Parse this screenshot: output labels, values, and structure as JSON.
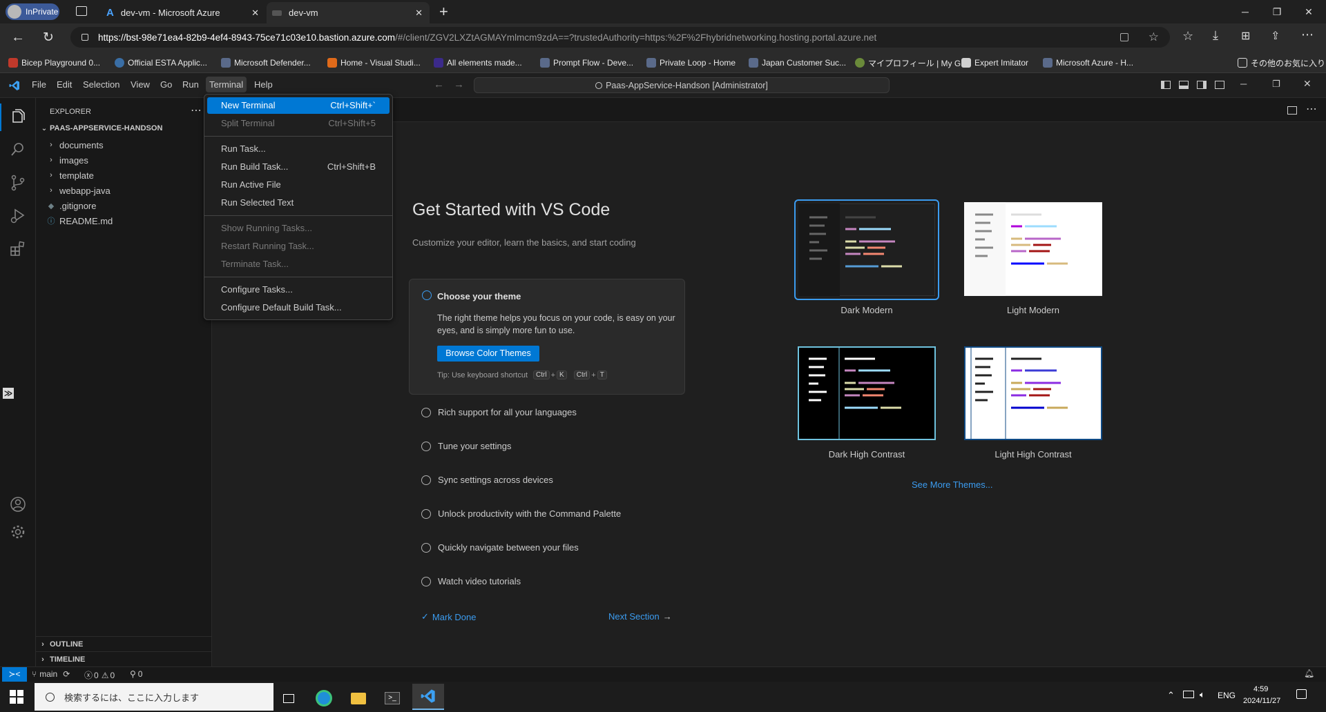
{
  "browser": {
    "inprivate_label": "InPrivate",
    "tabs": [
      {
        "title": "dev-vm - Microsoft Azure"
      },
      {
        "title": "dev-vm"
      }
    ],
    "url_host": "https://bst-98e71ea4-82b9-4ef4-8943-75ce71c03e10.bastion.azure.com",
    "url_rest": "/#/client/ZGV2LXZtAGMAYmlmcm9zdA==?trustedAuthority=https:%2F%2Fhybridnetworking.hosting.portal.azure.net",
    "favorites": [
      {
        "label": "Bicep Playground 0...",
        "color": "#c0392b"
      },
      {
        "label": "Official ESTA Applic...",
        "color": "#3a6ea5"
      },
      {
        "label": "Microsoft Defender...",
        "color": "#5a6a8a"
      },
      {
        "label": "Home - Visual Studi...",
        "color": "#e06a1a"
      },
      {
        "label": "All elements made...",
        "color": "#3b2a8a"
      },
      {
        "label": "Prompt Flow - Deve...",
        "color": "#5a6a8a"
      },
      {
        "label": "Private Loop - Home",
        "color": "#5a6a8a"
      },
      {
        "label": "Japan Customer Suc...",
        "color": "#5a6a8a"
      },
      {
        "label": "マイプロフィール | My G...",
        "color": "#6a8a3a"
      },
      {
        "label": "Expert Imitator",
        "color": "#d0d0d0"
      },
      {
        "label": "Microsoft Azure - H...",
        "color": "#5a6a8a"
      }
    ],
    "other_favorites": "その他のお気に入り"
  },
  "vscode": {
    "menu": [
      "File",
      "Edit",
      "Selection",
      "View",
      "Go",
      "Run",
      "Terminal",
      "Help"
    ],
    "command_center": "Paas-AppService-Handson [Administrator]",
    "explorer": {
      "title": "EXPLORER",
      "root": "PAAS-APPSERVICE-HANDSON",
      "items": [
        {
          "label": "documents",
          "type": "folder"
        },
        {
          "label": "images",
          "type": "folder"
        },
        {
          "label": "template",
          "type": "folder"
        },
        {
          "label": "webapp-java",
          "type": "folder"
        },
        {
          "label": ".gitignore",
          "type": "file"
        },
        {
          "label": "README.md",
          "type": "file"
        }
      ],
      "outline": "OUTLINE",
      "timeline": "TIMELINE"
    },
    "terminal_menu": {
      "new_terminal": {
        "label": "New Terminal",
        "key": "Ctrl+Shift+`"
      },
      "split_terminal": {
        "label": "Split Terminal",
        "key": "Ctrl+Shift+5"
      },
      "run_task": {
        "label": "Run Task..."
      },
      "run_build_task": {
        "label": "Run Build Task...",
        "key": "Ctrl+Shift+B"
      },
      "run_active_file": {
        "label": "Run Active File"
      },
      "run_selected_text": {
        "label": "Run Selected Text"
      },
      "show_running_tasks": {
        "label": "Show Running Tasks..."
      },
      "restart_running_task": {
        "label": "Restart Running Task..."
      },
      "terminate_task": {
        "label": "Terminate Task..."
      },
      "configure_tasks": {
        "label": "Configure Tasks..."
      },
      "configure_default_build": {
        "label": "Configure Default Build Task..."
      }
    },
    "welcome": {
      "title": "Get Started with VS Code",
      "subtitle": "Customize your editor, learn the basics, and start coding",
      "step_active": {
        "title": "Choose your theme",
        "desc": "The right theme helps you focus on your code, is easy on your eyes, and is simply more fun to use.",
        "button": "Browse Color Themes",
        "tip": "Tip: Use keyboard shortcut",
        "keys": [
          "Ctrl",
          "+",
          "K",
          "Ctrl",
          "+",
          "T"
        ]
      },
      "steps": [
        "Rich support for all your languages",
        "Tune your settings",
        "Sync settings across devices",
        "Unlock productivity with the Command Palette",
        "Quickly navigate between your files",
        "Watch video tutorials"
      ],
      "mark_done": "Mark Done",
      "next_section": "Next Section",
      "themes": [
        "Dark Modern",
        "Light Modern",
        "Dark High Contrast",
        "Light High Contrast"
      ],
      "see_more": "See More Themes..."
    },
    "status": {
      "branch": "main",
      "errors": "0",
      "warnings": "0",
      "ports": "0"
    }
  },
  "taskbar": {
    "search_placeholder": "検索するには、ここに入力します",
    "lang": "ENG",
    "time": "4:59",
    "date": "2024/11/27"
  }
}
